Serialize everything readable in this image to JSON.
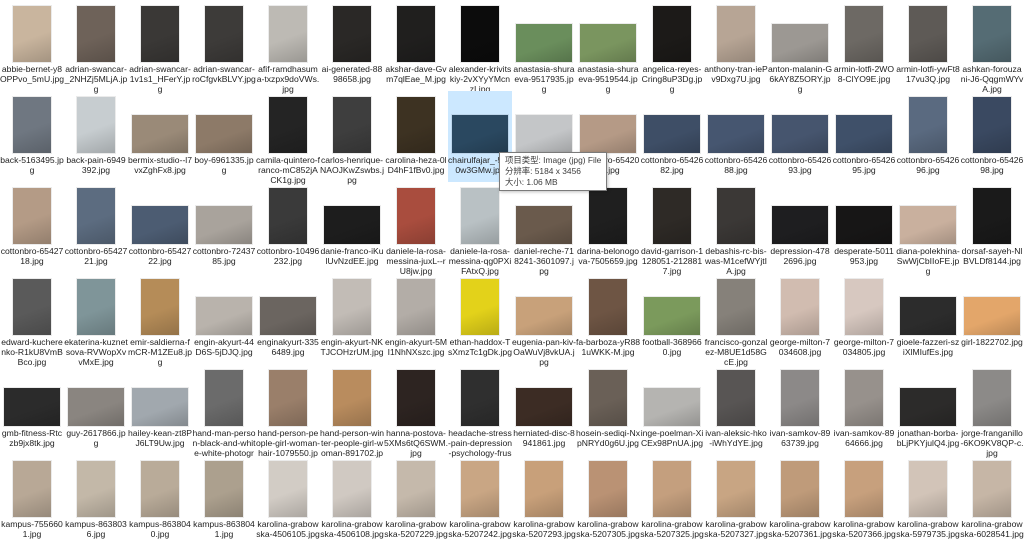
{
  "items": [
    {
      "name": "abbie-bernet-y8OPPvo_5mU.jpg",
      "color": "#c9b59e"
    },
    {
      "name": "adrian-swancar-_2NHZj5MLjA.jpg",
      "color": "#6e6259"
    },
    {
      "name": "adrian-swancar-1v1s1_HFerY.jpg",
      "color": "#3a3836"
    },
    {
      "name": "adrian-swancar-roCfgvkBLVY.jpg",
      "color": "#3d3b39"
    },
    {
      "name": "afif-ramdhasuma-txzpx9doVWs.jpg",
      "color": "#bdbab4"
    },
    {
      "name": "ai-generated-8898658.jpg",
      "color": "#2a2826"
    },
    {
      "name": "akshar-dave-Gvm7qlEae_M.jpg",
      "color": "#201f1e"
    },
    {
      "name": "alexander-krivitskiy-2vXYyYMcnzI.jpg",
      "color": "#0c0c0c"
    },
    {
      "name": "anastasia-shuraeva-9517935.jpg",
      "color": "#6a8e5c"
    },
    {
      "name": "anastasia-shuraeva-9519544.jpg",
      "color": "#7a955f"
    },
    {
      "name": "angelica-reyes-Cring8uP3Dg.jpg",
      "color": "#1c1a18"
    },
    {
      "name": "anthony-tran-iePv9Dxg7U.jpg",
      "color": "#b7a595"
    },
    {
      "name": "anton-malanin-G6kAY8Z5ORY.jpg",
      "color": "#9c9893"
    },
    {
      "name": "armin-lotfi-2WO8-ClYO9E.jpg",
      "color": "#6d6964"
    },
    {
      "name": "armin-lotfi-ywFt817vu3Q.jpg",
      "color": "#5e5a56"
    },
    {
      "name": "ashkan-forouzani-J6-QqgmWYvA.jpg",
      "color": "#556c74"
    },
    {
      "name": "back-5163495.jpg",
      "color": "#6f7781"
    },
    {
      "name": "back-pain-6949392.jpg",
      "color": "#c7cdd0"
    },
    {
      "name": "bermix-studio--l7vxZghFx8.jpg",
      "color": "#9a8a78"
    },
    {
      "name": "boy-6961335.jpg",
      "color": "#8d7a68"
    },
    {
      "name": "camila-quintero-franco-mC852jACK1g.jpg",
      "color": "#242424"
    },
    {
      "name": "carlos-henrique-NAOJKwZswbs.jpg",
      "color": "#3e3e3e"
    },
    {
      "name": "carolina-heza-0lD4hF1fBv0.jpg",
      "color": "#3d3222"
    },
    {
      "name": "chairulfajar_-5u40w3GMw.jpg",
      "color": "#2a4860"
    },
    {
      "name": "cottonbro-6542018.jpg",
      "color": "#c4c6c8"
    },
    {
      "name": "cottonbro-6542025.jpg",
      "color": "#b59a86"
    },
    {
      "name": "cottonbro-6542682.jpg",
      "color": "#3e4e66"
    },
    {
      "name": "cottonbro-6542688.jpg",
      "color": "#465670"
    },
    {
      "name": "cottonbro-6542693.jpg",
      "color": "#46556e"
    },
    {
      "name": "cottonbro-6542695.jpg",
      "color": "#3f5069"
    },
    {
      "name": "cottonbro-6542696.jpg",
      "color": "#5a6a80"
    },
    {
      "name": "cottonbro-6542698.jpg",
      "color": "#3a4961"
    },
    {
      "name": "cottonbro-6542718.jpg",
      "color": "#b49b86"
    },
    {
      "name": "cottonbro-6542721.jpg",
      "color": "#5c6c80"
    },
    {
      "name": "cottonbro-6542722.jpg",
      "color": "#4c5c72"
    },
    {
      "name": "cottonbro-7243785.jpg",
      "color": "#a9a39c"
    },
    {
      "name": "cottonbro-10496232.jpg",
      "color": "#3a3a3a"
    },
    {
      "name": "danie-franco-iKulUvNzdEE.jpg",
      "color": "#1d1d1d"
    },
    {
      "name": "daniele-la-rosa-messina-juxL--rU8jw.jpg",
      "color": "#a94d3e"
    },
    {
      "name": "daniele-la-rosa-messina-qg0PXiFAtxQ.jpg",
      "color": "#b9c1c4"
    },
    {
      "name": "daniel-reche-718241-3601097.jpg",
      "color": "#6a5a4c"
    },
    {
      "name": "darina-belonogova-7505659.jpg",
      "color": "#1f1f1f"
    },
    {
      "name": "david-garrison-1128051-2128817.jpg",
      "color": "#2e2a26"
    },
    {
      "name": "debashis-rc-bis-was-M1cefWYjtIA.jpg",
      "color": "#3b3836"
    },
    {
      "name": "depression-4782696.jpg",
      "color": "#1e1e20"
    },
    {
      "name": "desperate-5011953.jpg",
      "color": "#171616"
    },
    {
      "name": "diana-polekhina-SwWjCbIIoFE.jpg",
      "color": "#c9b09e"
    },
    {
      "name": "dorsaf-sayeh-NlBVLDf8144.jpg",
      "color": "#1a1a1a"
    },
    {
      "name": "edward-kucherenko-R1kU8VmBBco.jpg",
      "color": "#5a5a5a"
    },
    {
      "name": "ekaterina-kuznetsova-RVWopXvvMxE.jpg",
      "color": "#7f9599"
    },
    {
      "name": "emir-saldierna-fmCR-M1ZEu8.jpg",
      "color": "#b58c58"
    },
    {
      "name": "engin-akyurt-44D6S-5jDJQ.jpg",
      "color": "#b9b3ac"
    },
    {
      "name": "enginakyurt-3356489.jpg",
      "color": "#6b6560"
    },
    {
      "name": "engin-akyurt-NKTJCOHzrUM.jpg",
      "color": "#c2bcb6"
    },
    {
      "name": "engin-akyurt-5MI1NhNXszc.jpg",
      "color": "#b3ada7"
    },
    {
      "name": "ethan-haddox-TsXmzTc1gDk.jpg",
      "color": "#e3d21a"
    },
    {
      "name": "eugenia-pan-kiv-OaWuVj8vkUA.jpg",
      "color": "#c8a17a"
    },
    {
      "name": "fa-barboza-yR881uWKK-M.jpg",
      "color": "#6e5544"
    },
    {
      "name": "football-3689660.jpg",
      "color": "#7b9a5c"
    },
    {
      "name": "francisco-gonzalez-M8UE1d58GcE.jpg",
      "color": "#86817a"
    },
    {
      "name": "george-milton-7034608.jpg",
      "color": "#d1bcb0"
    },
    {
      "name": "george-milton-7034805.jpg",
      "color": "#d7c8c0"
    },
    {
      "name": "gioele-fazzeri-sziXlMIufEs.jpg",
      "color": "#2c2c2c"
    },
    {
      "name": "girl-1822702.jpg",
      "color": "#e3a66a"
    },
    {
      "name": "gmb-fitness-Rtczb9jx8tk.jpg",
      "color": "#2b2b2b"
    },
    {
      "name": "guy-2617866.jpg",
      "color": "#8a8580"
    },
    {
      "name": "hailey-kean-zt8PJ6LT9Uw.jpg",
      "color": "#a1a8ae"
    },
    {
      "name": "hand-man-person-black-and-white-white-photography-1048...",
      "color": "#6b6b6b"
    },
    {
      "name": "hand-person-people-girl-woman-hair-1079550.jpg",
      "color": "#9a7f6a"
    },
    {
      "name": "hand-person-winter-people-girl-woman-891702.jpg",
      "color": "#b98c5e"
    },
    {
      "name": "hanna-postova-5XMs6tQ6SWM.jpg",
      "color": "#2d2421"
    },
    {
      "name": "headache-stress-pain-depression-psychology-frustration-16...",
      "color": "#2f2f2f"
    },
    {
      "name": "herniated-disc-8941861.jpg",
      "color": "#3c2c24"
    },
    {
      "name": "hosein-sediqi-NxpNRYd0g6U.jpg",
      "color": "#6a6057"
    },
    {
      "name": "inge-poelman-XiCEx98PnUA.jpg",
      "color": "#b5b4b1"
    },
    {
      "name": "ivan-aleksic-hko-iWhYdYE.jpg",
      "color": "#585554"
    },
    {
      "name": "ivan-samkov-8963739.jpg",
      "color": "#8c8988"
    },
    {
      "name": "ivan-samkov-8964666.jpg",
      "color": "#97918c"
    },
    {
      "name": "jonathan-borba-bLjPKYjulQ4.jpg",
      "color": "#2c2b2a"
    },
    {
      "name": "jorge-franganillo-6KO9KV8QP-c.jpg",
      "color": "#8c8a88"
    },
    {
      "name": "kampus-7556601.jpg",
      "color": "#b8a896"
    },
    {
      "name": "kampus-8638036.jpg",
      "color": "#c3b8a8"
    },
    {
      "name": "kampus-8638040.jpg",
      "color": "#b9ab99"
    },
    {
      "name": "kampus-8638041.jpg",
      "color": "#aca08e"
    },
    {
      "name": "karolina-grabowska-4506105.jpg",
      "color": "#d2ccc5"
    },
    {
      "name": "karolina-grabowska-4506108.jpg",
      "color": "#d0c9c2"
    },
    {
      "name": "karolina-grabowska-5207229.jpg",
      "color": "#c5b9ab"
    },
    {
      "name": "karolina-grabowska-5207242.jpg",
      "color": "#c9a684"
    },
    {
      "name": "karolina-grabowska-5207293.jpg",
      "color": "#c8a07a"
    },
    {
      "name": "karolina-grabowska-5207305.jpg",
      "color": "#ba9274"
    },
    {
      "name": "karolina-grabowska-5207325.jpg",
      "color": "#c49f7e"
    },
    {
      "name": "karolina-grabowska-5207327.jpg",
      "color": "#c8a583"
    },
    {
      "name": "karolina-grabowska-5207361.jpg",
      "color": "#bf9b7a"
    },
    {
      "name": "karolina-grabowska-5207366.jpg",
      "color": "#c7a07d"
    },
    {
      "name": "karolina-grabowska-5979735.jpg",
      "color": "#d2c4b8"
    },
    {
      "name": "karolina-grabowska-6028541.jpg",
      "color": "#c6b6a6"
    }
  ],
  "thumb_shapes": [
    "p",
    "p",
    "p",
    "p",
    "p",
    "p",
    "p",
    "p",
    "l",
    "l",
    "p",
    "p",
    "l",
    "p",
    "p",
    "p",
    "p",
    "p",
    "l",
    "l",
    "p",
    "p",
    "p",
    "l",
    "l",
    "l",
    "l",
    "l",
    "l",
    "l",
    "p",
    "p",
    "p",
    "p",
    "l",
    "l",
    "p",
    "l",
    "p",
    "p",
    "l",
    "p",
    "p",
    "p",
    "l",
    "l",
    "l",
    "p",
    "p",
    "p",
    "p",
    "l",
    "l",
    "p",
    "p",
    "p",
    "l",
    "p",
    "l",
    "p",
    "p",
    "p",
    "l",
    "l",
    "l",
    "l",
    "l",
    "p",
    "p",
    "p",
    "p",
    "p",
    "l",
    "p",
    "l",
    "p",
    "p",
    "p",
    "l",
    "p",
    "p",
    "p",
    "p",
    "p",
    "p",
    "p",
    "p",
    "p",
    "p",
    "p",
    "p",
    "p",
    "p",
    "p",
    "p",
    "p"
  ],
  "selected_index": 23,
  "tooltip": {
    "type": "项目类型: Image (jpg) File",
    "dimensions": "分辨率: 5184 x 3456",
    "size": "大小: 1.06 MB"
  }
}
